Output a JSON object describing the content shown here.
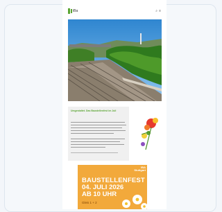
{
  "header": {
    "logo_text": "iBa",
    "icons": [
      "search-icon",
      "menu-icon"
    ]
  },
  "hero": {
    "alt": "Railway tracks and trees"
  },
  "section": {
    "title": "Umgestaltet. Das Baustellenfest im Juli"
  },
  "poster": {
    "corner_label": "IBA\nStuttgart",
    "line1": "BAUSTELLENFEST",
    "line2": "04. JULI 2026",
    "line3": "AB 10 UHR",
    "line4": "Gleis 1 + 2"
  },
  "colors": {
    "accent": "#5aa532",
    "poster": "#f2a93b"
  }
}
